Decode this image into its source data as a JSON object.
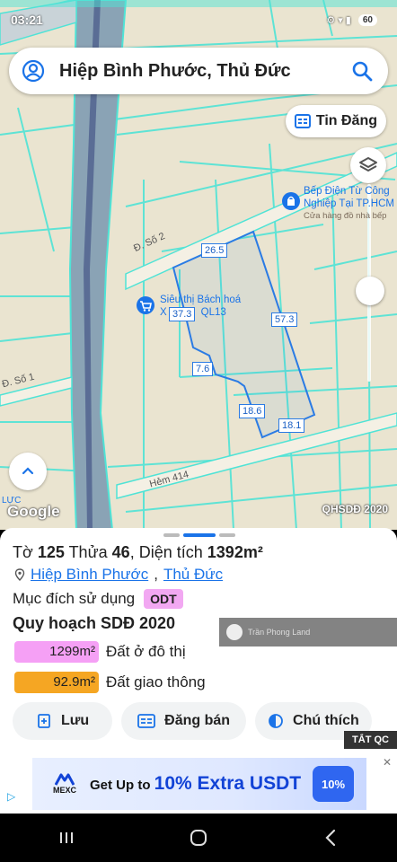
{
  "status_bar": {
    "time": "03:21",
    "battery": "60"
  },
  "search": {
    "query": "Hiệp Bình Phước, Thủ Đức"
  },
  "map": {
    "tin_dang_label": "Tin Đăng",
    "street_labels": [
      "Đ. Số 2",
      "Đ. Số 1",
      "Hẻm 414"
    ],
    "poi_1": {
      "name_line1": "Bếp Điện Từ Công",
      "name_line2": "Nghiệp Tại TP.HCM",
      "subtitle": "Cửa hàng đồ nhà bếp"
    },
    "poi_2": {
      "name_line1": "Siêu thị Bách hoá",
      "name_line2": "X",
      "name_line2_end": "QL13"
    },
    "dimensions": [
      "26.5",
      "57.3",
      "37.3",
      "7.6",
      "18.6",
      "18.1"
    ],
    "poi_3_partial": "LỰC",
    "google_label": "Google",
    "layer_label": "QHSDĐ 2020"
  },
  "parcel": {
    "to_label": "Tờ",
    "to_value": "125",
    "thua_label": "Thửa",
    "thua_value": "46",
    "area_label": "Diện tích",
    "area_value": "1392m²",
    "ward": "Hiệp Bình Phước",
    "district": "Thủ Đức",
    "purpose_label": "Mục đích sử dụng",
    "purpose_code": "ODT",
    "plan_title": "Quy hoạch SDĐ 2020",
    "land_uses": [
      {
        "area": "1299m²",
        "label": "Đất ở đô thị",
        "color": "#f5a0f5"
      },
      {
        "area": "92.9m²",
        "label": "Đất giao thông",
        "color": "#f5a623"
      }
    ]
  },
  "watermark": {
    "text": "Trần Phong Land"
  },
  "actions": {
    "save": "Lưu",
    "post_sale": "Đăng bán",
    "legend": "Chú thích"
  },
  "ad": {
    "close_label": "TẮT QC",
    "brand": "MEXC",
    "text_prefix": "Get Up to",
    "text_highlight": "10% Extra USDT",
    "badge": "10%"
  }
}
